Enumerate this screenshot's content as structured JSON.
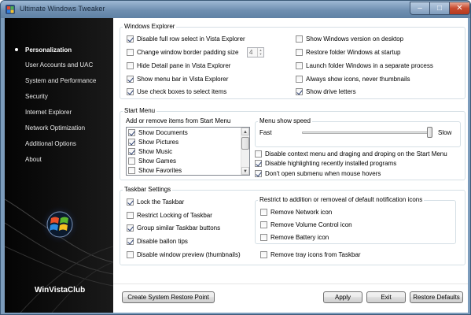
{
  "window": {
    "title": "Ultimate Windows Tweaker"
  },
  "sidebar": {
    "items": [
      {
        "label": "Personalization",
        "active": true
      },
      {
        "label": "User Accounts and UAC"
      },
      {
        "label": "System and Performance"
      },
      {
        "label": "Security"
      },
      {
        "label": "Internet Explorer"
      },
      {
        "label": "Network Optimization"
      },
      {
        "label": "Additional Options"
      },
      {
        "label": "About"
      }
    ],
    "brand": "WinVistaClub"
  },
  "windows_explorer": {
    "title": "Windows Explorer",
    "left": [
      {
        "label": "Disable full row select in Vista Explorer",
        "checked": true
      },
      {
        "label": "Change window border padding size",
        "checked": false
      },
      {
        "label": "Hide Detail pane in Vista Explorer",
        "checked": false
      },
      {
        "label": "Show menu bar in Vista Explorer",
        "checked": true
      },
      {
        "label": "Use check boxes to select items",
        "checked": true
      }
    ],
    "padding_value": "4",
    "right": [
      {
        "label": "Show Windows version on desktop",
        "checked": false
      },
      {
        "label": "Restore folder Windows at startup",
        "checked": false
      },
      {
        "label": "Launch folder Windows in a separate process",
        "checked": false
      },
      {
        "label": "Always show icons, never thumbnails",
        "checked": false
      },
      {
        "label": "Show drive letters",
        "checked": true
      }
    ]
  },
  "start_menu": {
    "title": "Start Menu",
    "list_title": "Add or remove items from Start Menu",
    "items": [
      {
        "label": "Show Documents",
        "checked": true
      },
      {
        "label": "Show Pictures",
        "checked": true
      },
      {
        "label": "Show Music",
        "checked": true
      },
      {
        "label": "Show Games",
        "checked": false
      },
      {
        "label": "Show Favorites",
        "checked": false
      }
    ],
    "speed_title": "Menu show speed",
    "speed_fast": "Fast",
    "speed_slow": "Slow",
    "speed_level": 1.0,
    "options": [
      {
        "label": "Disable context menu and draging and droping on the Start Menu",
        "checked": false
      },
      {
        "label": "Disable highlighting recently installed programs",
        "checked": true
      },
      {
        "label": "Don't open submenu when mouse hovers",
        "checked": true
      }
    ]
  },
  "taskbar": {
    "title": "Taskbar Settings",
    "left": [
      {
        "label": "Lock the Taskbar",
        "checked": true
      },
      {
        "label": "Restrict Locking of Taskbar",
        "checked": false
      },
      {
        "label": "Group similar Taskbar buttons",
        "checked": true
      },
      {
        "label": "Disable ballon tips",
        "checked": true
      },
      {
        "label": "Disable window preview (thumbnails)",
        "checked": false
      }
    ],
    "restrict_title": "Restrict to addition or removeal of default notification icons",
    "restrict": [
      {
        "label": "Remove Network icon",
        "checked": false
      },
      {
        "label": "Remove Volume Control icon",
        "checked": false
      },
      {
        "label": "Remove Battery icon",
        "checked": false
      }
    ],
    "tray": {
      "label": "Remove tray icons from Taskbar",
      "checked": false
    }
  },
  "footer": {
    "restore_point": "Create System Restore Point",
    "apply": "Apply",
    "exit": "Exit",
    "restore_defaults": "Restore Defaults"
  }
}
